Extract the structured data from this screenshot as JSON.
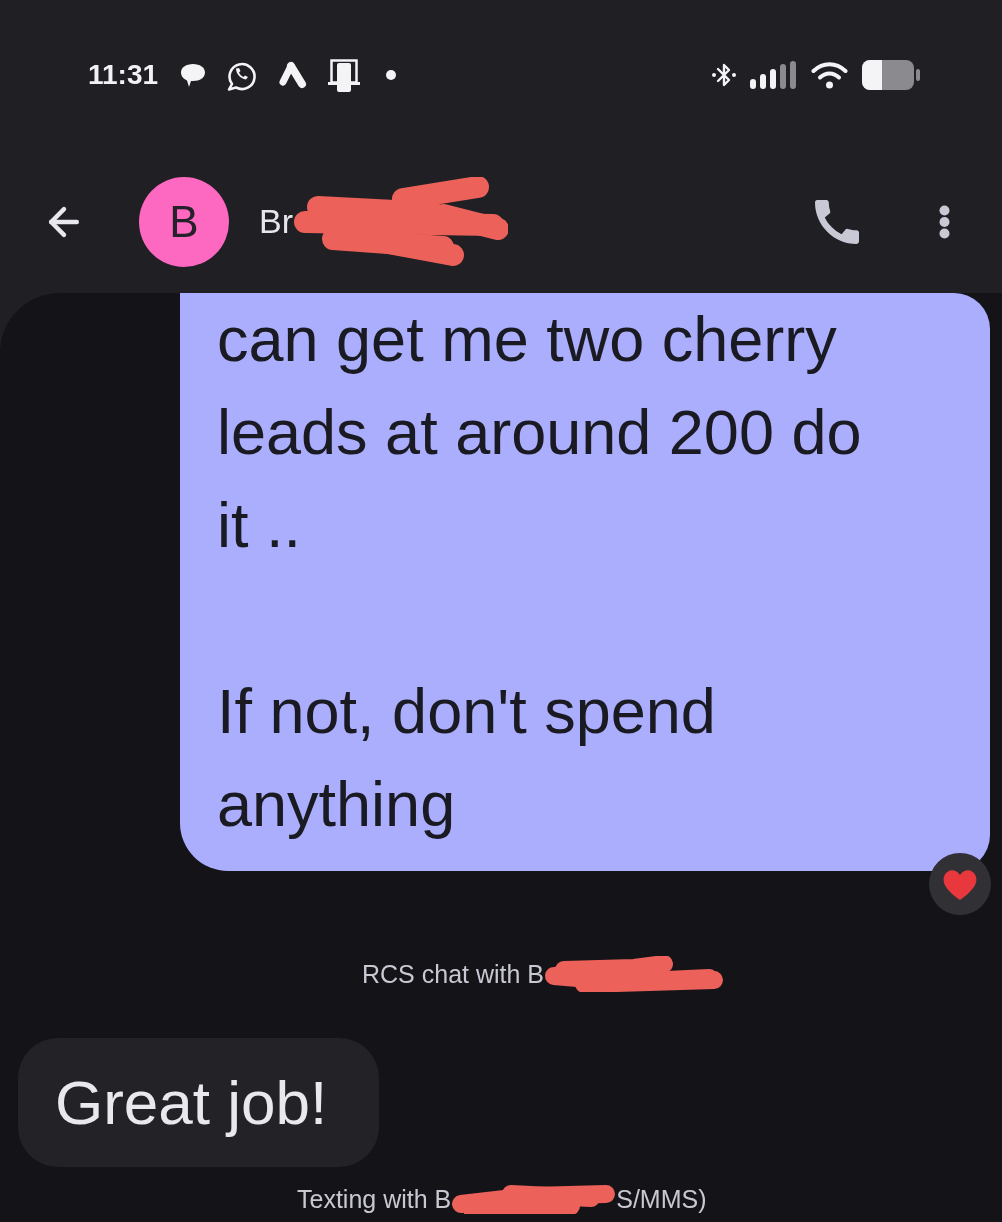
{
  "status_bar": {
    "time": "11:31"
  },
  "header": {
    "avatar_initial": "B",
    "contact_name": "Br",
    "redacted": true
  },
  "messages": [
    {
      "kind": "sent",
      "text": "can get me two cherry leads at around 200 do it ..\n\nIf not, don't spend anything",
      "reacted": true
    },
    {
      "kind": "system",
      "text": "RCS chat with B",
      "redacted": true
    },
    {
      "kind": "received",
      "text": "Great job!"
    },
    {
      "kind": "system",
      "text": "Texting with B",
      "redacted": true,
      "text_after": "S/MMS)"
    }
  ]
}
